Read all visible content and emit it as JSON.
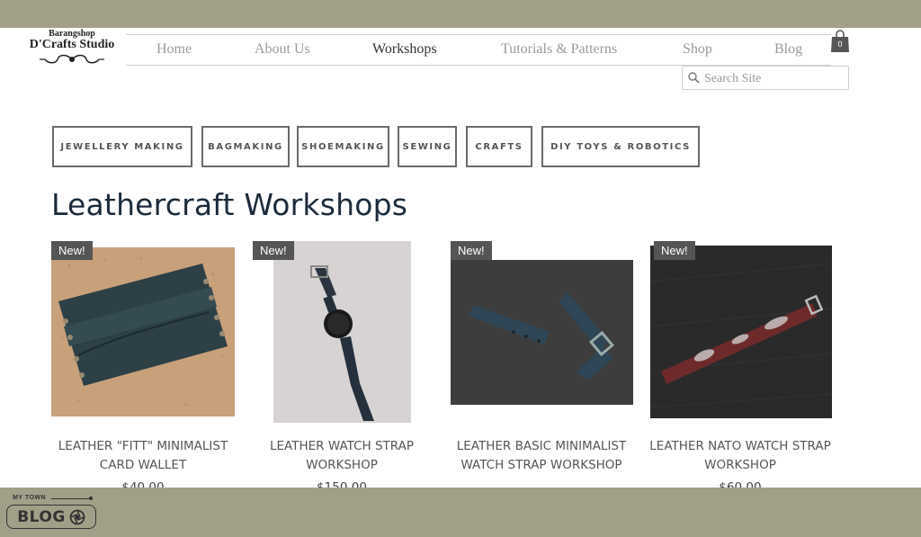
{
  "logo": {
    "top_text": "Barangshop",
    "main_text": "D'Crafts Studio"
  },
  "nav": {
    "items": [
      {
        "label": "Home"
      },
      {
        "label": "About Us"
      },
      {
        "label": "Workshops"
      },
      {
        "label": "Tutorials & Patterns"
      },
      {
        "label": "Shop"
      },
      {
        "label": "Blog"
      }
    ],
    "active": "Workshops"
  },
  "cart": {
    "count": "0",
    "icon": "shopping-bag-icon"
  },
  "search": {
    "placeholder": "Search Site",
    "value": "",
    "icon": "magnifier-icon"
  },
  "categories": [
    {
      "label": "JEWELLERY MAKING"
    },
    {
      "label": "BAGMAKING"
    },
    {
      "label": "SHOEMAKING"
    },
    {
      "label": "SEWING"
    },
    {
      "label": "CRAFTS"
    },
    {
      "label": "DIY TOYS & ROBOTICS"
    }
  ],
  "page_title": "Leathercraft Workshops",
  "products": [
    {
      "badge": "New!",
      "name": "LEATHER \"FITT\" MINIMALIST CARD WALLET",
      "price": "$40.00"
    },
    {
      "badge": "New!",
      "name": "LEATHER WATCH STRAP WORKSHOP",
      "price": "$150.00"
    },
    {
      "badge": "New!",
      "name": "LEATHER BASIC MINIMALIST WATCH STRAP WORKSHOP",
      "price": ""
    },
    {
      "badge": "New!",
      "name": "LEATHER NATO WATCH STRAP WORKSHOP",
      "price": "$60.00"
    }
  ],
  "footer_badge": {
    "tag": "MY TOWN",
    "label": "BLOG",
    "icon": "aperture-icon"
  },
  "colors": {
    "band": "#a29f88",
    "title": "#1b2b3b",
    "badge_bg": "#555555",
    "button_border": "#6a6a6a"
  }
}
